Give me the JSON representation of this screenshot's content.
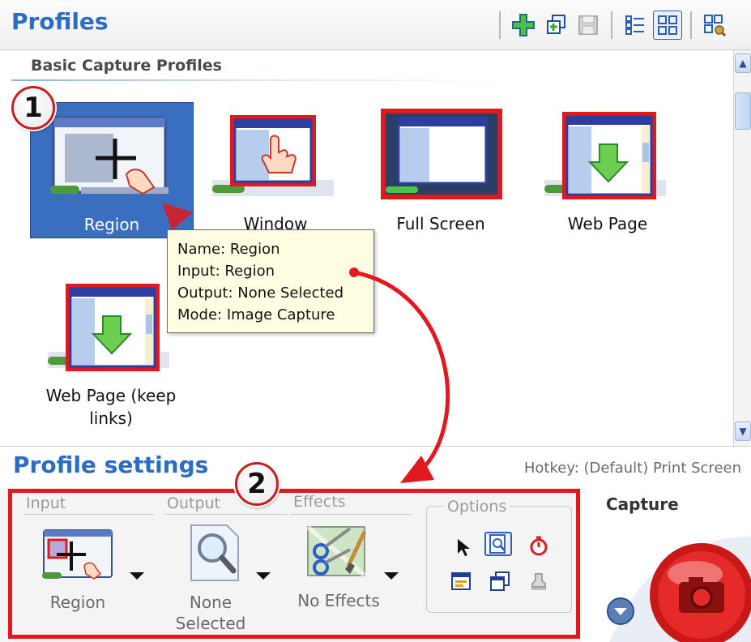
{
  "app": {
    "title": "Profiles"
  },
  "toolbar": {
    "buttons": [
      {
        "icon": "add-profile-icon"
      },
      {
        "icon": "duplicate-profile-icon"
      },
      {
        "icon": "save-profile-icon"
      },
      {
        "icon": "details-view-icon"
      },
      {
        "icon": "tiles-view-icon",
        "active": true
      },
      {
        "icon": "manage-profiles-icon"
      }
    ]
  },
  "profiles": {
    "section_title": "Basic Capture Profiles",
    "items": [
      {
        "label": "Region",
        "selected": true
      },
      {
        "label": "Window"
      },
      {
        "label": "Full Screen"
      },
      {
        "label": "Web Page"
      },
      {
        "label": "Web Page (keep links)"
      }
    ],
    "tooltip": {
      "name": "Name: Region",
      "input": "Input: Region",
      "output": "Output: None Selected",
      "mode": "Mode: Image Capture"
    }
  },
  "callouts": {
    "one": "1",
    "two": "2"
  },
  "settings": {
    "title": "Profile settings",
    "hotkey": "Hotkey: (Default) Print Screen",
    "input": {
      "group": "Input",
      "value": "Region"
    },
    "output": {
      "group": "Output",
      "value_line1": "None",
      "value_line2": "Selected"
    },
    "effects": {
      "group": "Effects",
      "value": "No Effects"
    },
    "options": {
      "group": "Options",
      "icons": [
        "cursor-icon",
        "preview-icon",
        "timer-icon",
        "window-capture-icon",
        "multiple-windows-icon",
        "stamp-icon"
      ]
    },
    "capture": {
      "label": "Capture"
    }
  },
  "colors": {
    "accent": "#2b6dc3",
    "highlight": "#e0191f",
    "selection": "#3a6fc0",
    "tooltip_bg": "#fffee3"
  }
}
